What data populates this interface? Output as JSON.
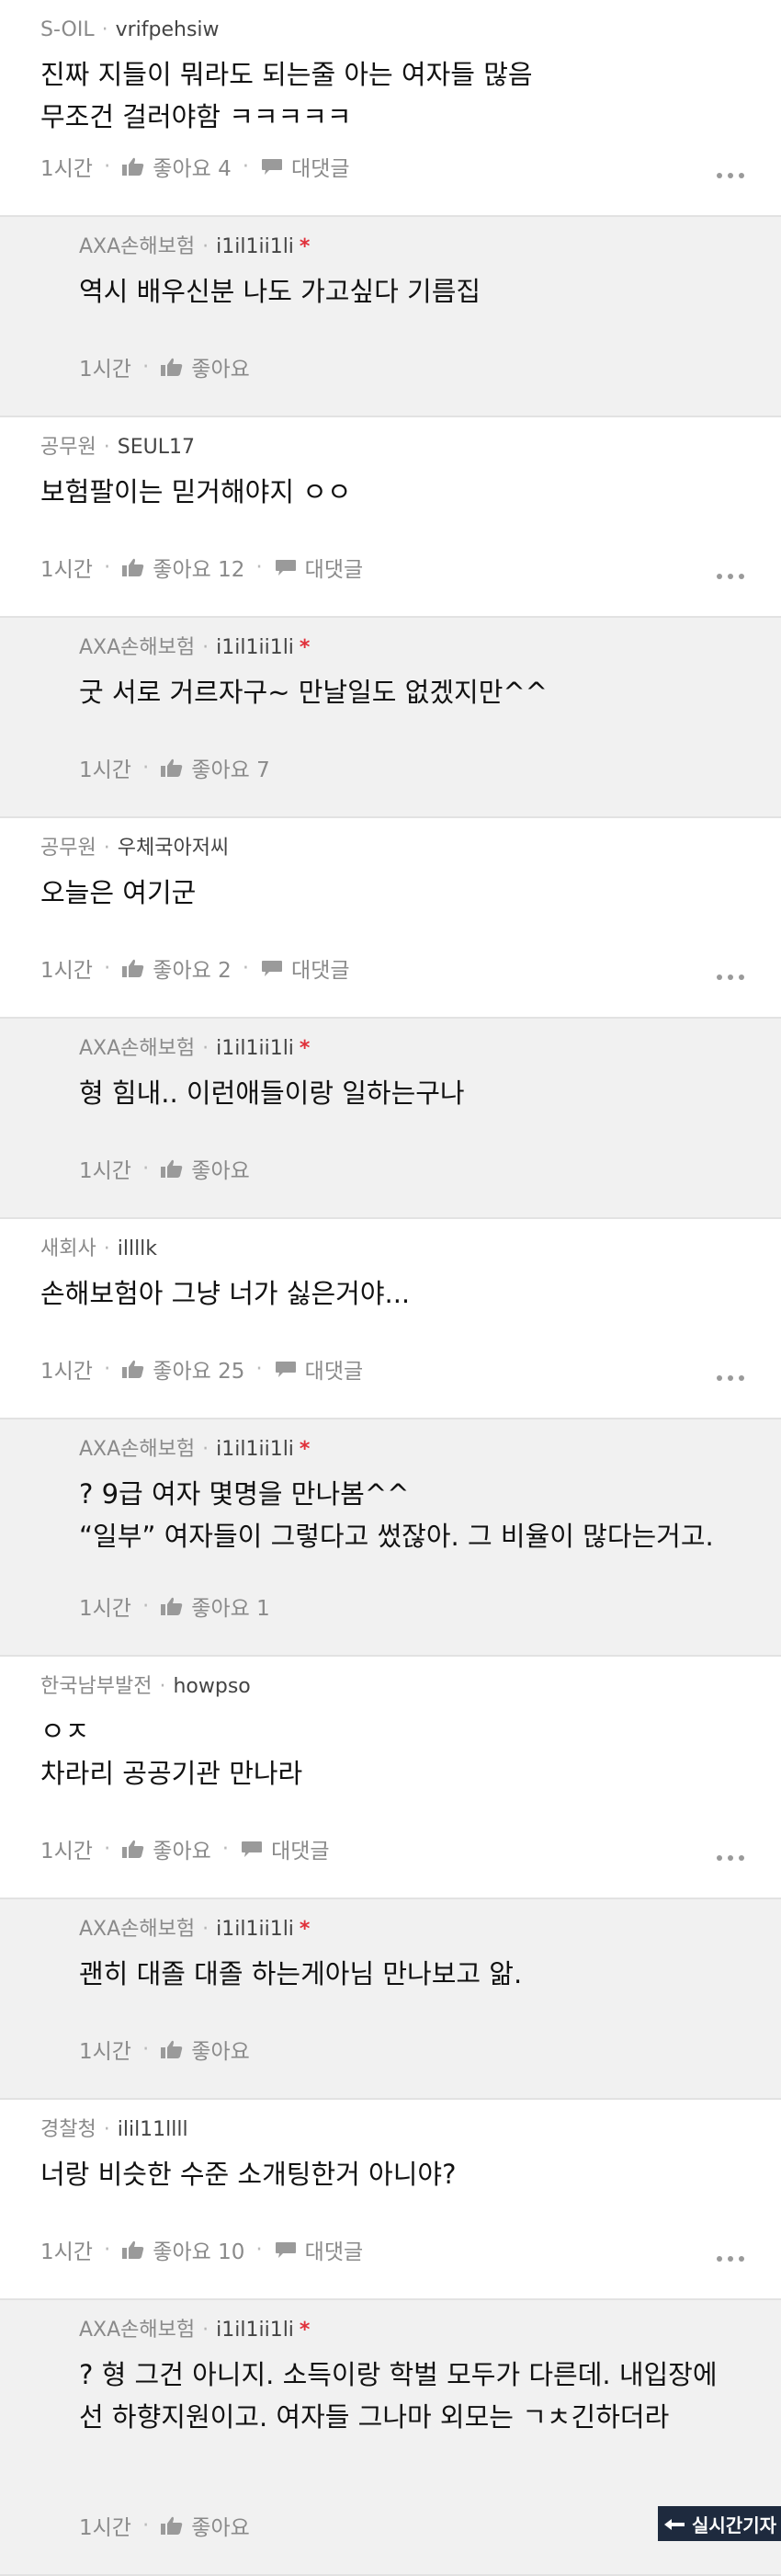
{
  "comments": [
    {
      "type": "top",
      "company": "S-OIL",
      "nick": "vrifpehsiw",
      "lines": [
        "진짜 지들이 뭐라도 되는줄 아는 여자들 많음",
        "무조건 걸러야함 ㅋㅋㅋㅋㅋ"
      ],
      "time": "1시간",
      "likes": "좋아요 4",
      "reply": "대댓글"
    },
    {
      "type": "reply",
      "company": "AXA손해보험",
      "nick": "i1il1ii1li",
      "lines": [
        "역시 배우신분 나도 가고싶다 기름집"
      ],
      "time": "1시간",
      "likes": "좋아요"
    },
    {
      "type": "top",
      "company": "공무원",
      "nick": "SEUL17",
      "lines": [
        "보험팔이는 믿거해야지 ㅇㅇ"
      ],
      "time": "1시간",
      "likes": "좋아요 12",
      "reply": "대댓글"
    },
    {
      "type": "reply",
      "company": "AXA손해보험",
      "nick": "i1il1ii1li",
      "lines": [
        "굿 서로 거르자구~ 만날일도 없겠지만^^"
      ],
      "time": "1시간",
      "likes": "좋아요 7"
    },
    {
      "type": "top",
      "company": "공무원",
      "nick": "우체국아저씨",
      "lines": [
        "오늘은 여기군"
      ],
      "time": "1시간",
      "likes": "좋아요 2",
      "reply": "대댓글"
    },
    {
      "type": "reply",
      "company": "AXA손해보험",
      "nick": "i1il1ii1li",
      "lines": [
        "형 힘내.. 이런애들이랑 일하는구나"
      ],
      "time": "1시간",
      "likes": "좋아요"
    },
    {
      "type": "top",
      "company": "새회사",
      "nick": "illllk",
      "lines": [
        "손해보험아 그냥 너가 싫은거야..."
      ],
      "time": "1시간",
      "likes": "좋아요 25",
      "reply": "대댓글"
    },
    {
      "type": "reply",
      "company": "AXA손해보험",
      "nick": "i1il1ii1li",
      "lines": [
        "? 9급 여자 몇명을 만나봄^^",
        "“일부” 여자들이 그렇다고 썼잖아. 그 비율이 많다는거고."
      ],
      "time": "1시간",
      "likes": "좋아요 1"
    },
    {
      "type": "top",
      "company": "한국남부발전",
      "nick": "howpso",
      "lines": [
        "ㅇㅈ",
        "차라리 공공기관 만나라"
      ],
      "time": "1시간",
      "likes": "좋아요",
      "reply": "대댓글"
    },
    {
      "type": "reply",
      "company": "AXA손해보험",
      "nick": "i1il1ii1li",
      "lines": [
        "괜히 대졸 대졸 하는게아님 만나보고 앎."
      ],
      "time": "1시간",
      "likes": "좋아요"
    },
    {
      "type": "top",
      "company": "경찰청",
      "nick": "ilil11llll",
      "lines": [
        "너랑 비슷한 수준 소개팅한거 아니야?"
      ],
      "time": "1시간",
      "likes": "좋아요 10",
      "reply": "대댓글"
    },
    {
      "type": "reply",
      "company": "AXA손해보험",
      "nick": "i1il1ii1li",
      "lines": [
        "? 형 그건 아니지. 소득이랑 학벌 모두가 다른데. 내입장에",
        "선 하향지원이고. 여자들 그나마 외모는 ㄱㅊ긴하더라"
      ],
      "time": "1시간",
      "likes": "좋아요"
    }
  ],
  "watermark": {
    "text": "실시간기자"
  },
  "icons": {
    "like": "thumbs-up-icon",
    "reply": "speech-bubble-icon",
    "more": "more-dots-icon"
  },
  "colors": {
    "reply_bg": "#f1f1f1",
    "top_bg": "#ffffff",
    "author_dot": "#e0303a",
    "divider": "#e2e2e2"
  }
}
